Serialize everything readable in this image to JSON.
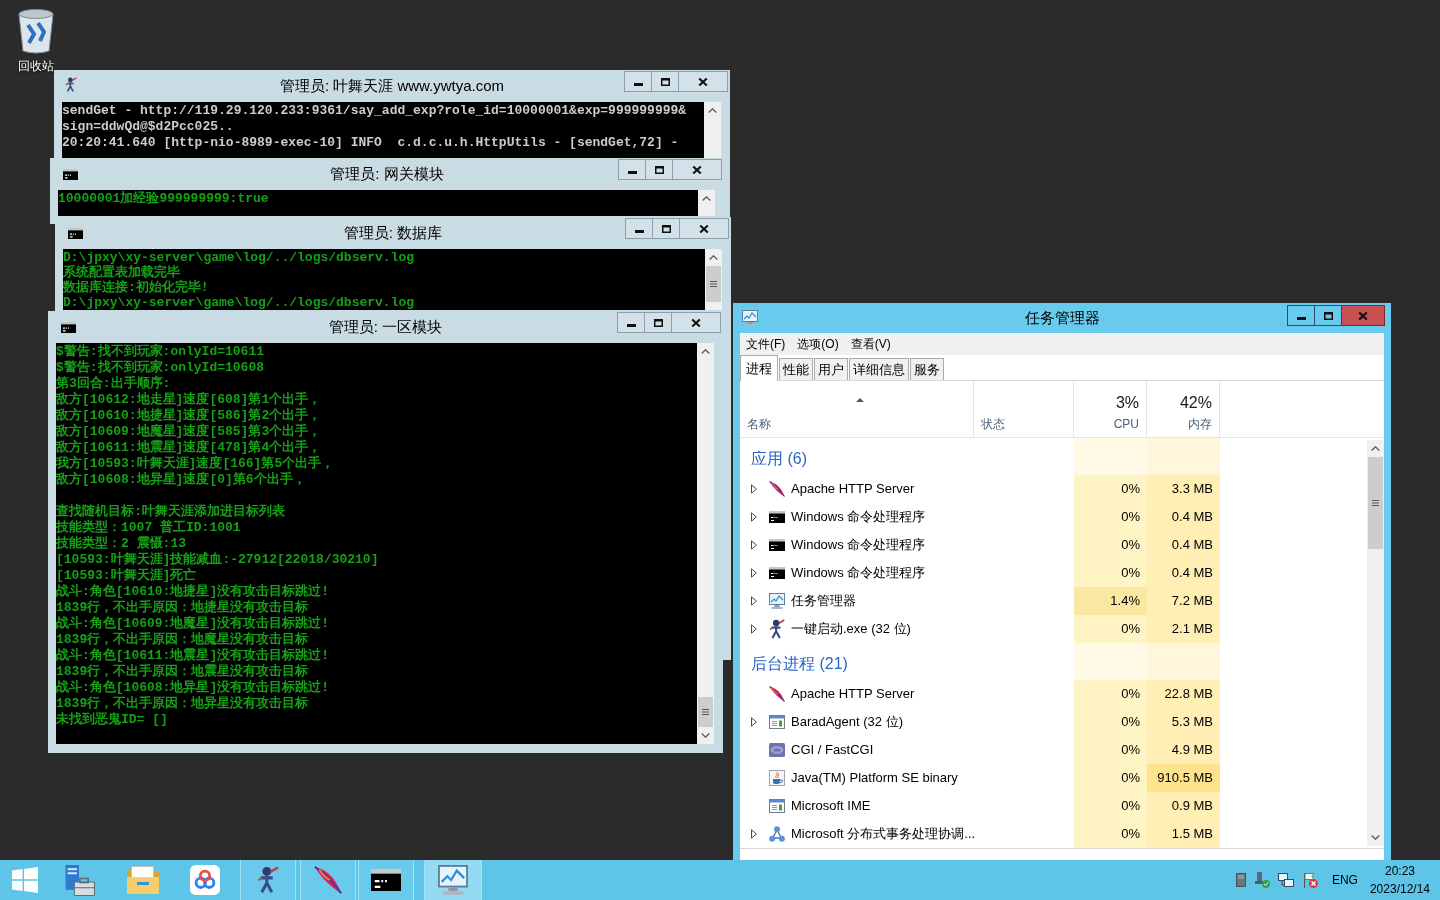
{
  "desktop": {
    "icons": [
      {
        "label": "回收站"
      }
    ]
  },
  "consoles": [
    {
      "title": "管理员: 叶舞天涯 www.ywtya.com",
      "kind": "character",
      "active": false,
      "blocks": [
        [
          "sendGet - http://119.29.120.233:9361/say_add_exp?role_id=10000001&exp=999999999&",
          "sign=ddwQd@$d2Pcc025..",
          "20:20:41.640 [http-nio-8989-exec-10] INFO  c.d.c.u.h.HttpUtils - [sendGet,72] -"
        ]
      ]
    },
    {
      "title": "管理员: 网关模块",
      "kind": "terminal",
      "active": false,
      "blocks": [
        [
          "10000001加经验999999999:true"
        ]
      ]
    },
    {
      "title": "管理员: 数据库",
      "kind": "terminal",
      "active": false,
      "blocks": [
        [
          "D:\\jpxy\\xy-server\\game\\log/../logs/dbserv.log",
          "系统配置表加载完毕",
          "数据库连接:初始化完毕!",
          "D:\\jpxy\\xy-server\\game\\log/../logs/dbserv.log"
        ]
      ]
    },
    {
      "title": "管理员: 一区模块",
      "kind": "terminal",
      "active": false,
      "blocks": [
        [
          "$警告:找不到玩家:onlyId=10611",
          "$警告:找不到玩家:onlyId=10608",
          "第3回合:出手顺序:",
          "敌方[10612:地走星]速度[608]第1个出手，",
          "敌方[10610:地捷星]速度[586]第2个出手，",
          "敌方[10609:地魔星]速度[585]第3个出手，",
          "敌方[10611:地震星]速度[478]第4个出手，",
          "我方[10593:叶舞天涯]速度[166]第5个出手，",
          "敌方[10608:地异星]速度[0]第6个出手，"
        ],
        [
          "查找随机目标:叶舞天涯添加进目标列表",
          "技能类型：1007 普工ID:1001",
          "技能类型：2 震慑:13",
          "[10593:叶舞天涯]技能减血:-27912[22018/30210]",
          "[10593:叶舞天涯]死亡",
          "战斗:角色[10610:地捷星]没有攻击目标跳过!",
          "1839行，不出手原因：地捷星没有攻击目标",
          "战斗:角色[10609:地魔星]没有攻击目标跳过!",
          "1839行，不出手原因：地魔星没有攻击目标",
          "战斗:角色[10611:地震星]没有攻击目标跳过!",
          "1839行，不出手原因：地震星没有攻击目标",
          "战斗:角色[10608:地异星]没有攻击目标跳过!",
          "1839行，不出手原因：地异星没有攻击目标",
          "未找到恶鬼ID= []"
        ]
      ]
    }
  ],
  "task_manager": {
    "title": "任务管理器",
    "active": true,
    "menu": [
      "文件(F)",
      "选项(O)",
      "查看(V)"
    ],
    "tabs": [
      {
        "label": "进程",
        "selected": true
      },
      {
        "label": "性能",
        "selected": false
      },
      {
        "label": "用户",
        "selected": false
      },
      {
        "label": "详细信息",
        "selected": false
      },
      {
        "label": "服务",
        "selected": false
      }
    ],
    "columns": [
      {
        "label": "名称",
        "sorted": true
      },
      {
        "label": "状态",
        "sorted": false
      },
      {
        "label": "CPU",
        "total": "3%",
        "sorted": false
      },
      {
        "label": "内存",
        "total": "42%",
        "sorted": false
      }
    ],
    "groups": [
      {
        "title": "应用 (6)",
        "processes": [
          {
            "name": "Apache HTTP Server",
            "kind": "feather",
            "expandable": true,
            "cpu": "0%",
            "memory": "3.3 MB",
            "cpu_high": false,
            "memory_high": false
          },
          {
            "name": "Windows 命令处理程序",
            "kind": "terminal",
            "expandable": true,
            "cpu": "0%",
            "memory": "0.4 MB",
            "cpu_high": false,
            "memory_high": false
          },
          {
            "name": "Windows 命令处理程序",
            "kind": "terminal",
            "expandable": true,
            "cpu": "0%",
            "memory": "0.4 MB",
            "cpu_high": false,
            "memory_high": false
          },
          {
            "name": "Windows 命令处理程序",
            "kind": "terminal",
            "expandable": true,
            "cpu": "0%",
            "memory": "0.4 MB",
            "cpu_high": false,
            "memory_high": false
          },
          {
            "name": "任务管理器",
            "kind": "monitor",
            "expandable": true,
            "cpu": "1.4%",
            "memory": "7.2 MB",
            "cpu_high": true,
            "memory_high": false
          },
          {
            "name": "一键启动.exe (32 位)",
            "kind": "character",
            "expandable": true,
            "cpu": "0%",
            "memory": "2.1 MB",
            "cpu_high": false,
            "memory_high": false
          }
        ]
      },
      {
        "title": "后台进程 (21)",
        "processes": [
          {
            "name": "Apache HTTP Server",
            "kind": "feather",
            "expandable": false,
            "cpu": "0%",
            "memory": "22.8 MB",
            "cpu_high": false,
            "memory_high": false
          },
          {
            "name": "BaradAgent (32 位)",
            "kind": "window",
            "expandable": true,
            "cpu": "0%",
            "memory": "5.3 MB",
            "cpu_high": false,
            "memory_high": false
          },
          {
            "name": "CGI / FastCGI",
            "kind": "tile",
            "expandable": false,
            "cpu": "0%",
            "memory": "4.9 MB",
            "cpu_high": false,
            "memory_high": false
          },
          {
            "name": "Java(TM) Platform SE binary",
            "kind": "cup",
            "expandable": false,
            "cpu": "0%",
            "memory": "910.5 MB",
            "cpu_high": false,
            "memory_high": true
          },
          {
            "name": "Microsoft IME",
            "kind": "window",
            "expandable": false,
            "cpu": "0%",
            "memory": "0.9 MB",
            "cpu_high": false,
            "memory_high": false
          },
          {
            "name": "Microsoft 分布式事务处理协调...",
            "kind": "nodes",
            "expandable": true,
            "cpu": "0%",
            "memory": "1.5 MB",
            "cpu_high": false,
            "memory_high": false
          }
        ]
      }
    ]
  },
  "taskbar": {
    "items": [
      {
        "kind": "start",
        "running": false,
        "selected": false
      },
      {
        "kind": "server",
        "running": false,
        "selected": false
      },
      {
        "kind": "folder",
        "running": false,
        "selected": false
      },
      {
        "kind": "cloud",
        "running": false,
        "selected": false
      },
      {
        "kind": "character",
        "running": true,
        "selected": false
      },
      {
        "kind": "feather",
        "running": true,
        "selected": false
      },
      {
        "kind": "terminal",
        "running": true,
        "selected": false
      },
      {
        "kind": "monitor",
        "running": true,
        "selected": true
      }
    ],
    "tray": [
      {
        "kind": "rectangle"
      },
      {
        "kind": "device"
      },
      {
        "kind": "monitors"
      },
      {
        "kind": "flag"
      }
    ],
    "language": "ENG",
    "time": "20:23",
    "date": "2023/12/14"
  }
}
